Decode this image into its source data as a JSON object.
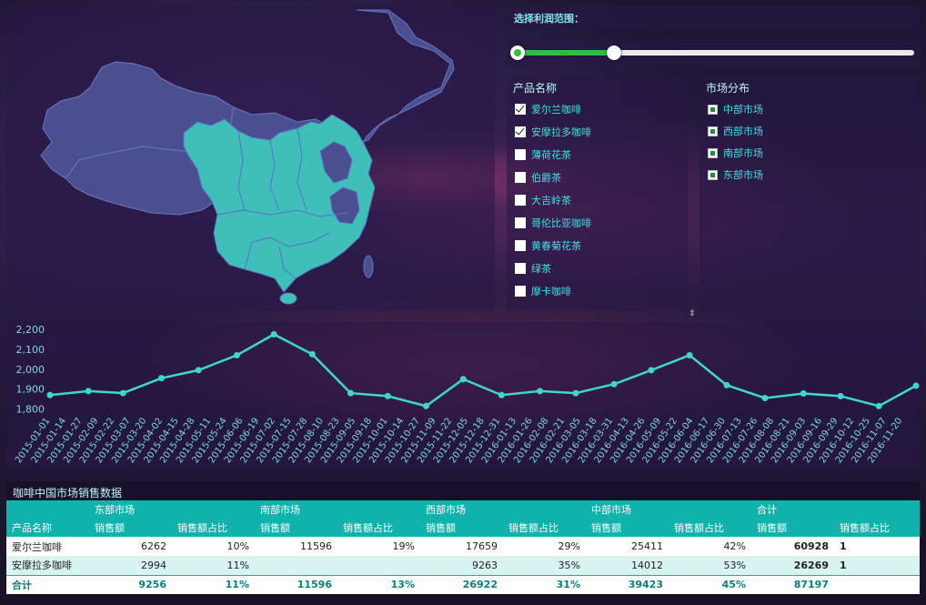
{
  "range": {
    "label": "选择利润范围：",
    "value_fraction": 0.25
  },
  "products": {
    "title": "产品名称",
    "items": [
      {
        "label": "爱尔兰咖啡",
        "checked": true
      },
      {
        "label": "安摩拉多咖啡",
        "checked": true
      },
      {
        "label": "薄荷花茶",
        "checked": false
      },
      {
        "label": "伯爵茶",
        "checked": false
      },
      {
        "label": "大吉岭茶",
        "checked": false
      },
      {
        "label": "哥伦比亚咖啡",
        "checked": false
      },
      {
        "label": "黄春菊花茶",
        "checked": false
      },
      {
        "label": "绿茶",
        "checked": false
      },
      {
        "label": "摩卡咖啡",
        "checked": false
      }
    ]
  },
  "markets": {
    "title": "市场分布",
    "items": [
      {
        "label": "中部市场"
      },
      {
        "label": "西部市场"
      },
      {
        "label": "南部市场"
      },
      {
        "label": "东部市场"
      }
    ]
  },
  "colors": {
    "accent": "#10b3ab",
    "line": "#3fd6d0",
    "map_base": "#4a4f8f",
    "map_highlight": "#3fbfb8"
  },
  "chart_data": {
    "type": "line",
    "title": "",
    "xlabel": "",
    "ylabel": "",
    "ylim": [
      1780,
      2200
    ],
    "yticks": [
      "1,800",
      "1,900",
      "2,000",
      "2,100",
      "2,200"
    ],
    "x": [
      "2015-01-01",
      "2015-01-14",
      "2015-01-27",
      "2015-02-09",
      "2015-02-22",
      "2015-03-07",
      "2015-03-20",
      "2015-04-02",
      "2015-04-15",
      "2015-04-28",
      "2015-05-11",
      "2015-05-24",
      "2015-06-06",
      "2015-06-19",
      "2015-07-02",
      "2015-07-15",
      "2015-07-28",
      "2015-08-10",
      "2015-08-23",
      "2015-09-05",
      "2015-09-18",
      "2015-10-01",
      "2015-10-14",
      "2015-10-27",
      "2015-11-09",
      "2015-11-22",
      "2015-12-05",
      "2015-12-18",
      "2015-12-31",
      "2016-01-13",
      "2016-01-26",
      "2016-02-08",
      "2016-02-21",
      "2016-03-05",
      "2016-03-18",
      "2016-03-31",
      "2016-04-13",
      "2016-04-26",
      "2016-05-09",
      "2016-05-22",
      "2016-06-04",
      "2016-06-17",
      "2016-06-30",
      "2016-07-13",
      "2016-07-26",
      "2016-08-08",
      "2016-08-21",
      "2016-09-03",
      "2016-09-16",
      "2016-09-29",
      "2016-10-12",
      "2016-10-25",
      "2016-11-07",
      "2016-11-20"
    ],
    "point_dates": [
      "2015-01-01",
      "2015-02-01",
      "2015-03-01",
      "2015-04-01",
      "2015-05-01",
      "2015-06-01",
      "2015-07-01",
      "2015-08-01",
      "2015-09-01",
      "2015-10-01",
      "2015-11-01",
      "2015-12-01",
      "2016-01-01",
      "2016-02-01",
      "2016-03-01",
      "2016-04-01",
      "2016-05-01",
      "2016-06-01",
      "2016-07-01",
      "2016-08-01",
      "2016-09-01",
      "2016-10-01",
      "2016-11-01",
      "2016-12-01"
    ],
    "values": [
      1870,
      1890,
      1880,
      1955,
      1995,
      2070,
      2175,
      2075,
      1880,
      1865,
      1815,
      1950,
      1870,
      1890,
      1880,
      1925,
      1995,
      2070,
      1920,
      1855,
      1878,
      1865,
      1815,
      1917
    ]
  },
  "table": {
    "title": "咖啡中国市场销售数据",
    "group_headers": [
      "",
      "东部市场",
      "南部市场",
      "西部市场",
      "中部市场",
      "合计"
    ],
    "sub_headers": [
      "产品名称",
      "销售额",
      "销售额占比",
      "销售额",
      "销售额占比",
      "销售额",
      "销售额占比",
      "销售额",
      "销售额占比",
      "销售额",
      "销售额占比"
    ],
    "rows": [
      [
        "爱尔兰咖啡",
        "6262",
        "10%",
        "11596",
        "19%",
        "17659",
        "29%",
        "25411",
        "42%",
        "60928",
        "1"
      ],
      [
        "安摩拉多咖啡",
        "2994",
        "11%",
        "",
        "",
        "9263",
        "35%",
        "14012",
        "53%",
        "26269",
        "1"
      ]
    ],
    "total": [
      "合计",
      "9256",
      "11%",
      "11596",
      "13%",
      "26922",
      "31%",
      "39423",
      "45%",
      "87197",
      ""
    ]
  }
}
